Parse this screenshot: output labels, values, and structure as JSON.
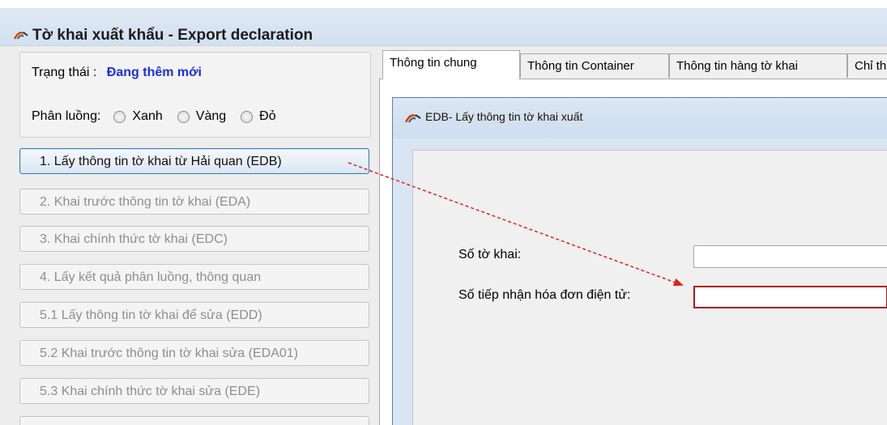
{
  "window": {
    "title": "Tờ khai xuất khẩu - Export declaration"
  },
  "status": {
    "trang_thai_label": "Trạng thái :",
    "trang_thai_value": "Đang thêm mới",
    "phan_luong_label": "Phân luồng:",
    "options": [
      "Xanh",
      "Vàng",
      "Đỏ"
    ]
  },
  "steps": [
    "1. Lấy thông tin tờ khai từ Hải quan (EDB)",
    "2. Khai trước thông tin tờ khai (EDA)",
    "3. Khai chính thức tờ khai (EDC)",
    "4. Lấy kết quả phân luồng, thông quan",
    "5.1 Lấy thông tin tờ khai để sửa (EDD)",
    "5.2 Khai trước thông tin tờ khai sửa (EDA01)",
    "5.3 Khai chính thức tờ khai sửa (EDE)"
  ],
  "tabs": [
    "Thông tin chung",
    "Thông tin Container",
    "Thông tin hàng tờ khai",
    "Chỉ th"
  ],
  "dialog": {
    "title": "EDB- Lấy thông tin tờ khai xuất",
    "fields": {
      "so_to_khai": {
        "label": "Số tờ khai:",
        "value": ""
      },
      "so_tiep_nhan": {
        "label": "Số tiếp nhận hóa đơn điện tử:",
        "value": ""
      }
    }
  },
  "colors": {
    "status_value": "#1a2ee6",
    "annotation_arrow": "#e02020",
    "error_border": "#a81a1a"
  }
}
